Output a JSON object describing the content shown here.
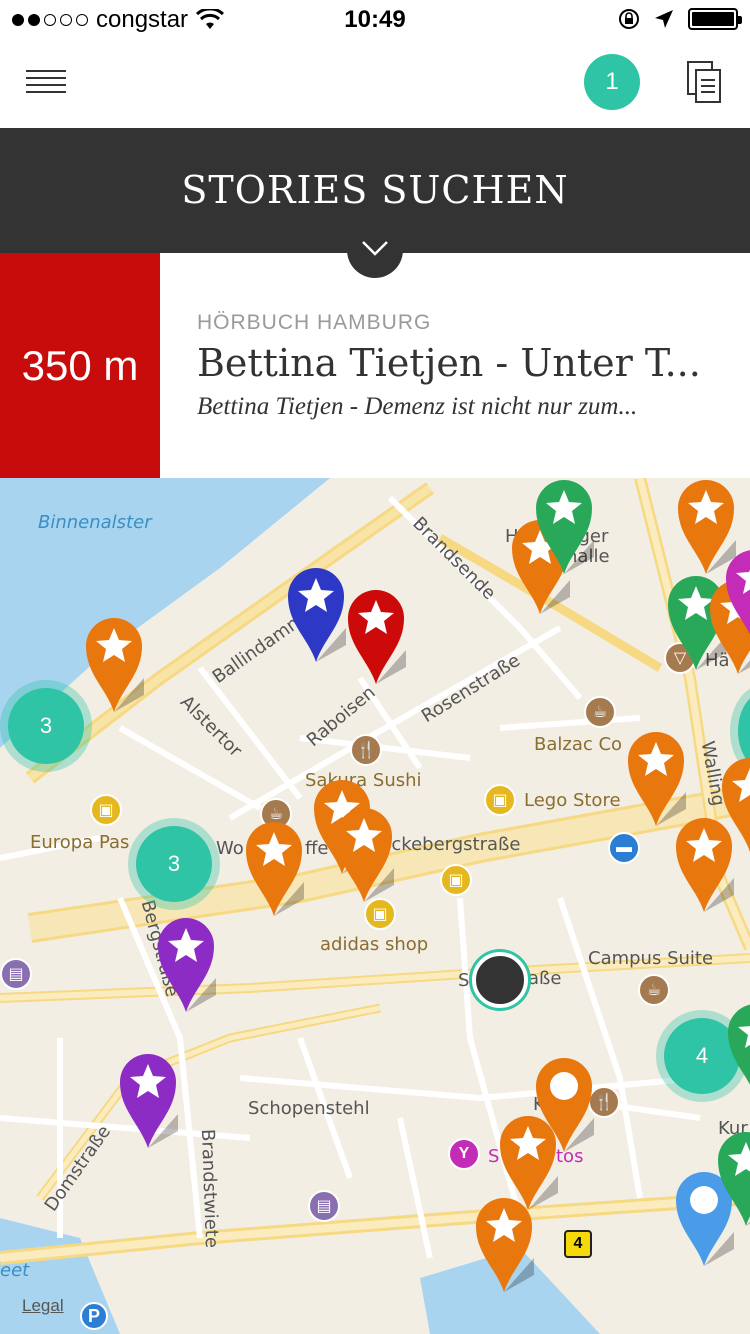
{
  "status_bar": {
    "carrier": "congstar",
    "time": "10:49",
    "signal_bars_filled": 2,
    "signal_bars_total": 5,
    "battery_level": 1.0
  },
  "nav": {
    "menu_icon": "hamburger-icon",
    "notification_count": "1",
    "docs_icon": "documents-icon",
    "accent_color": "#2ec4a5"
  },
  "header": {
    "title": "STORIES SUCHEN",
    "toggle_icon": "chevron-down-icon",
    "background_color": "#333333"
  },
  "story": {
    "distance": "350 m",
    "category": "HÖRBUCH HAMBURG",
    "title": "Bettina Tietjen - Unter T...",
    "subtitle": "Bettina Tietjen - Demenz ist nicht nur zum...",
    "distance_color": "#c80b0b"
  },
  "map": {
    "labels": {
      "binnenalster": "Binnenalster",
      "ballindamm": "Ballindamm",
      "brandsende": "Brandsende",
      "hamburger_halle_1": "H",
      "hamburger_halle_2": "urger",
      "hamburger_halle_3": "halle",
      "rosenstrasse": "Rosenstraße",
      "raboisen": "Raboisen",
      "alstertor": "Alstertor",
      "balzac": "Balzac Co",
      "wallring": "Walling",
      "sakura": "Sakura Sushi",
      "lego": "Lego Store",
      "europa": "Europa Pas",
      "wo": "Wo",
      "ffe": "ffe",
      "monckeberg": "nckebergstraße",
      "adidas": "adidas shop",
      "bergstrasse": "Bergstraße",
      "campus": "Campus Suite",
      "s_strasse_1": "S",
      "s_strasse_2": "aße",
      "schopenstehl": "Schopenstehl",
      "domstrasse": "Domstraße",
      "brandstwiete": "Brandstwiete",
      "k": "K",
      "s_tos_1": "S",
      "s_tos_2": "tos",
      "kur": "Kur",
      "eet": "eet",
      "ha": "Hä"
    },
    "legal": "Legal",
    "parking": "P",
    "route_shield": "4",
    "clusters": [
      {
        "id": "west",
        "count": "3"
      },
      {
        "id": "center",
        "count": "3"
      },
      {
        "id": "east",
        "count": "4"
      }
    ],
    "pin_colors": {
      "orange": "#e8770e",
      "red": "#cc0a0a",
      "blue": "#2d39c4",
      "purple": "#8c2cc4",
      "green": "#2aa85a",
      "light_blue": "#4a9be8",
      "magenta": "#c42cb8"
    }
  }
}
